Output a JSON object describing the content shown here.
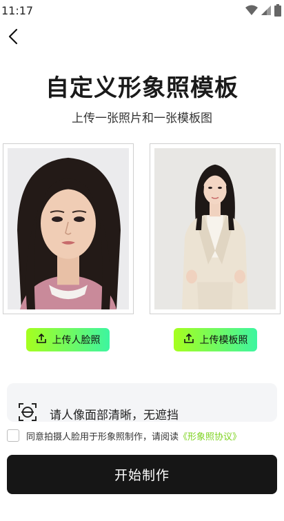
{
  "status_bar": {
    "time": "11:17",
    "icons": [
      "wifi-icon",
      "cellular-signal-icon",
      "battery-icon"
    ]
  },
  "header": {
    "back_icon": "chevron-left-icon"
  },
  "main": {
    "title": "自定义形象照模板",
    "subtitle": "上传一张照片和一张模板图"
  },
  "photos": {
    "face_photo_desc": "face-photo",
    "template_photo_desc": "template-photo"
  },
  "buttons": {
    "upload_face": "上传人脸照",
    "upload_template": "上传模板照",
    "upload_icon": "upload-icon",
    "start": "开始制作"
  },
  "tip": {
    "icon": "face-scan-icon",
    "text": "请人像面部清晰，无遮挡"
  },
  "agreement": {
    "checked": false,
    "text": "同意拍摄人脸用于形象照制作，请阅读",
    "link": "《形象照协议》"
  },
  "colors": {
    "accent_start": "#a6ff1e",
    "accent_end": "#3df5a0",
    "link": "#7ed321",
    "primary_button": "#161616"
  }
}
